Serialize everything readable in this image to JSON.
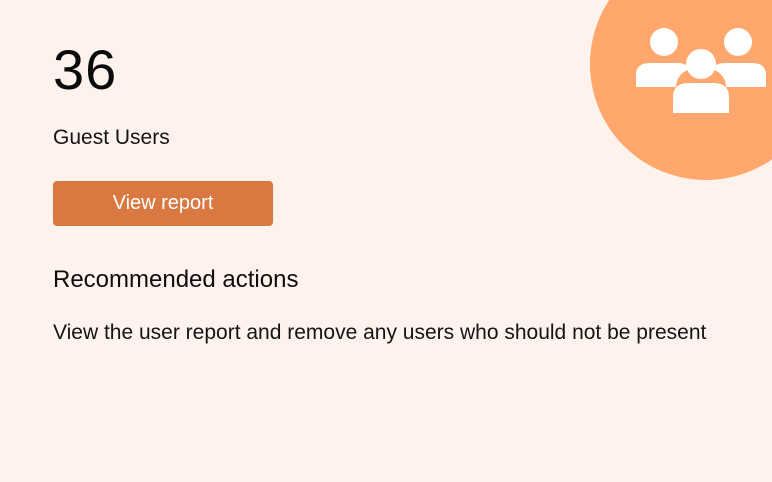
{
  "card": {
    "count": "36",
    "subtitle": "Guest Users",
    "button_label": "View report",
    "icon": "users-group-icon"
  },
  "recommendations": {
    "heading": "Recommended actions",
    "body": "View the user report and remove any users who should not be present"
  },
  "colors": {
    "background": "#fef2ec",
    "accent_circle": "#ffa76c",
    "button": "#d97941",
    "icon": "#ffffff"
  }
}
